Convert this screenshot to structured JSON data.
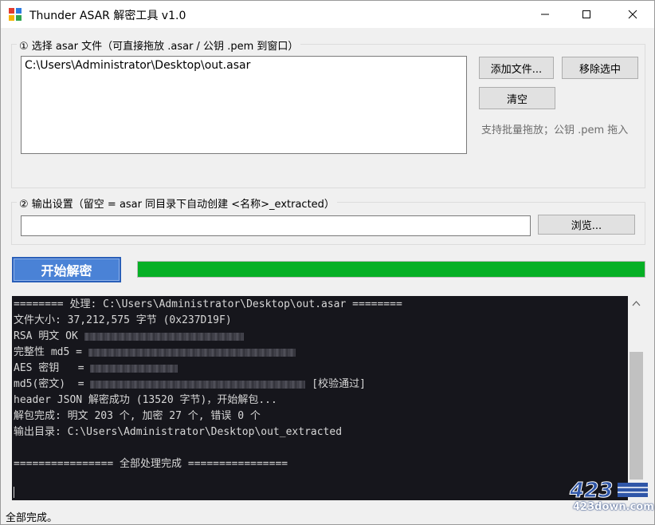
{
  "window": {
    "title": "Thunder ASAR 解密工具 v1.0",
    "controls": {
      "minimize": "─",
      "maximize": "☐",
      "close": "✕"
    }
  },
  "section1": {
    "label": "① 选择 asar 文件（可直接拖放 .asar / 公钥 .pem 到窗口）",
    "files": [
      "C:\\Users\\Administrator\\Desktop\\out.asar"
    ],
    "add_button": "添加文件...",
    "remove_button": "移除选中",
    "clear_button": "清空",
    "hint": "支持批量拖放；公钥 .pem 拖入"
  },
  "section2": {
    "label": "② 输出设置（留空 = asar 同目录下自动创建 <名称>_extracted）",
    "output_value": "",
    "browse_button": "浏览..."
  },
  "start_button": "开始解密",
  "progress": {
    "value": 1.0,
    "color": "#06b025"
  },
  "console": {
    "lines": [
      {
        "pre": "======== 处理: C:\\Users\\Administrator\\Desktop\\out.asar ========",
        "post": ""
      },
      {
        "pre": "文件大小: 37,212,575 字节 (0x237D19F)",
        "post": ""
      },
      {
        "pre": "RSA 明文 OK ",
        "post": ""
      },
      {
        "pre": "完整性 md5 = ",
        "post": ""
      },
      {
        "pre": "AES 密钥   = ",
        "post": ""
      },
      {
        "pre": "md5(密文)  = ",
        "post": " [校验通过]"
      },
      {
        "pre": "header JSON 解密成功 (13520 字节)，开始解包...",
        "post": ""
      },
      {
        "pre": "解包完成: 明文 203 个, 加密 27 个, 错误 0 个",
        "post": ""
      },
      {
        "pre": "输出目录: C:\\Users\\Administrator\\Desktop\\out_extracted",
        "post": ""
      },
      {
        "pre": "",
        "post": ""
      },
      {
        "pre": "================ 全部处理完成 ================",
        "post": ""
      }
    ]
  },
  "status_bar": "全部完成。",
  "watermark": {
    "text": "423down.com"
  }
}
